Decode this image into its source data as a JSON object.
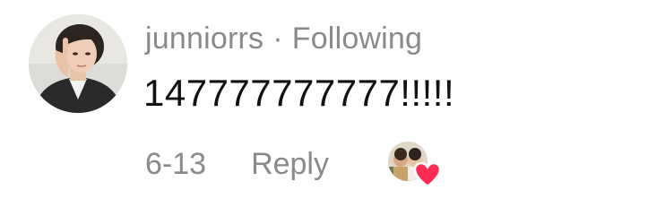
{
  "comment": {
    "username": "junniorrs",
    "separator": "·",
    "follow_status": "Following",
    "text": "147777777777!!!!!",
    "date": "6-13",
    "reply_label": "Reply",
    "liked_by_creator": true
  },
  "icons": {
    "avatar": "profile-avatar",
    "liker_avatar": "creator-avatar",
    "heart": "heart-icon"
  },
  "colors": {
    "muted_text": "#8a8a8a",
    "body_text": "#111111",
    "heart": "#fe2c55"
  }
}
